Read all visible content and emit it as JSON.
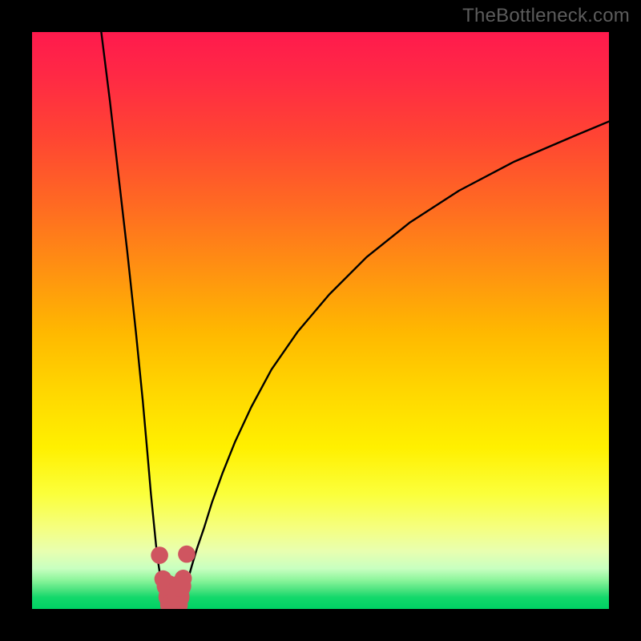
{
  "watermark": "TheBottleneck.com",
  "chart_data": {
    "type": "line",
    "title": "",
    "xlabel": "",
    "ylabel": "",
    "xlim": [
      0,
      100
    ],
    "ylim": [
      0,
      100
    ],
    "grid": false,
    "legend": false,
    "background_gradient": {
      "top": "#ff1a4d",
      "mid": "#ffee00",
      "bottom": "#00d264"
    },
    "series": [
      {
        "name": "left-arm",
        "stroke": "#000000",
        "x": [
          12.0,
          13.5,
          15.0,
          16.5,
          18.0,
          19.2,
          20.0,
          20.6,
          21.1,
          21.5,
          21.8,
          22.1,
          22.3,
          22.5,
          22.7,
          22.85,
          23.0
        ],
        "y": [
          100.0,
          88.0,
          75.0,
          62.0,
          48.0,
          36.0,
          27.0,
          20.0,
          15.0,
          11.0,
          8.5,
          6.5,
          5.0,
          3.8,
          2.8,
          2.0,
          1.4
        ]
      },
      {
        "name": "right-arm",
        "stroke": "#000000",
        "x": [
          26.0,
          26.5,
          27.0,
          27.7,
          28.6,
          29.8,
          31.2,
          33.0,
          35.2,
          38.0,
          41.5,
          46.0,
          51.5,
          58.0,
          65.5,
          74.0,
          83.5,
          94.0,
          100.0
        ],
        "y": [
          1.4,
          3.0,
          5.0,
          7.5,
          10.5,
          14.0,
          18.5,
          23.5,
          29.0,
          35.0,
          41.5,
          48.0,
          54.5,
          61.0,
          67.0,
          72.5,
          77.5,
          82.0,
          84.5
        ]
      }
    ],
    "markers": [
      {
        "name": "left-dot-upper",
        "x": 22.1,
        "y": 9.3,
        "r": 1.5,
        "fill": "#cf5560"
      },
      {
        "name": "left-dot-lower",
        "x": 22.7,
        "y": 5.2,
        "r": 1.5,
        "fill": "#cf5560"
      },
      {
        "name": "right-dot-upper",
        "x": 26.8,
        "y": 9.5,
        "r": 1.5,
        "fill": "#cf5560"
      },
      {
        "name": "right-dot-lower",
        "x": 26.2,
        "y": 5.3,
        "r": 1.5,
        "fill": "#cf5560"
      },
      {
        "name": "valley-stem-left",
        "x": 23.5,
        "y": 4.0,
        "r": 1.9,
        "fill": "#cf5560"
      },
      {
        "name": "valley-stem-left2",
        "x": 23.8,
        "y": 2.1,
        "r": 1.9,
        "fill": "#cf5560"
      },
      {
        "name": "valley-base-left",
        "x": 24.0,
        "y": 0.7,
        "r": 1.8,
        "fill": "#cf5560"
      },
      {
        "name": "valley-base-right",
        "x": 25.2,
        "y": 0.7,
        "r": 1.8,
        "fill": "#cf5560"
      },
      {
        "name": "valley-stem-right2",
        "x": 25.4,
        "y": 2.1,
        "r": 1.9,
        "fill": "#cf5560"
      },
      {
        "name": "valley-stem-right",
        "x": 25.7,
        "y": 4.0,
        "r": 1.9,
        "fill": "#cf5560"
      }
    ]
  }
}
